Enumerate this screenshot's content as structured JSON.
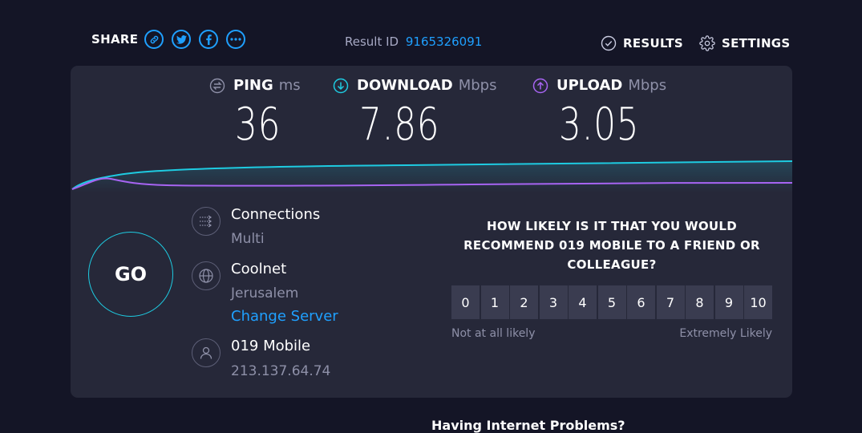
{
  "header": {
    "share_label": "SHARE",
    "share_icons": [
      "link-icon",
      "twitter-icon",
      "facebook-icon",
      "more-icon"
    ],
    "result_label": "Result ID",
    "result_id": "9165326091",
    "results_label": "RESULTS",
    "settings_label": "SETTINGS"
  },
  "metrics": {
    "ping": {
      "label": "PING",
      "unit": "ms",
      "value": "36"
    },
    "download": {
      "label": "DOWNLOAD",
      "unit": "Mbps",
      "value": "7.86"
    },
    "upload": {
      "label": "UPLOAD",
      "unit": "Mbps",
      "value": "3.05"
    }
  },
  "colors": {
    "accent": "#1fa0ff",
    "download": "#1ecbe1",
    "upload": "#a764f2",
    "background": "#141526",
    "panel": "#262839"
  },
  "go_label": "GO",
  "connections": {
    "title": "Connections",
    "value": "Multi"
  },
  "server": {
    "name": "Coolnet",
    "location": "Jerusalem",
    "change_label": "Change Server"
  },
  "provider": {
    "name": "019 Mobile",
    "ip": "213.137.64.74"
  },
  "survey": {
    "question": "HOW LIKELY IS IT THAT YOU WOULD RECOMMEND 019 MOBILE TO A FRIEND OR COLLEAGUE?",
    "options": [
      "0",
      "1",
      "2",
      "3",
      "4",
      "5",
      "6",
      "7",
      "8",
      "9",
      "10"
    ],
    "low_label": "Not at all likely",
    "high_label": "Extremely Likely"
  },
  "footer_peek": "Having Internet Problems?"
}
